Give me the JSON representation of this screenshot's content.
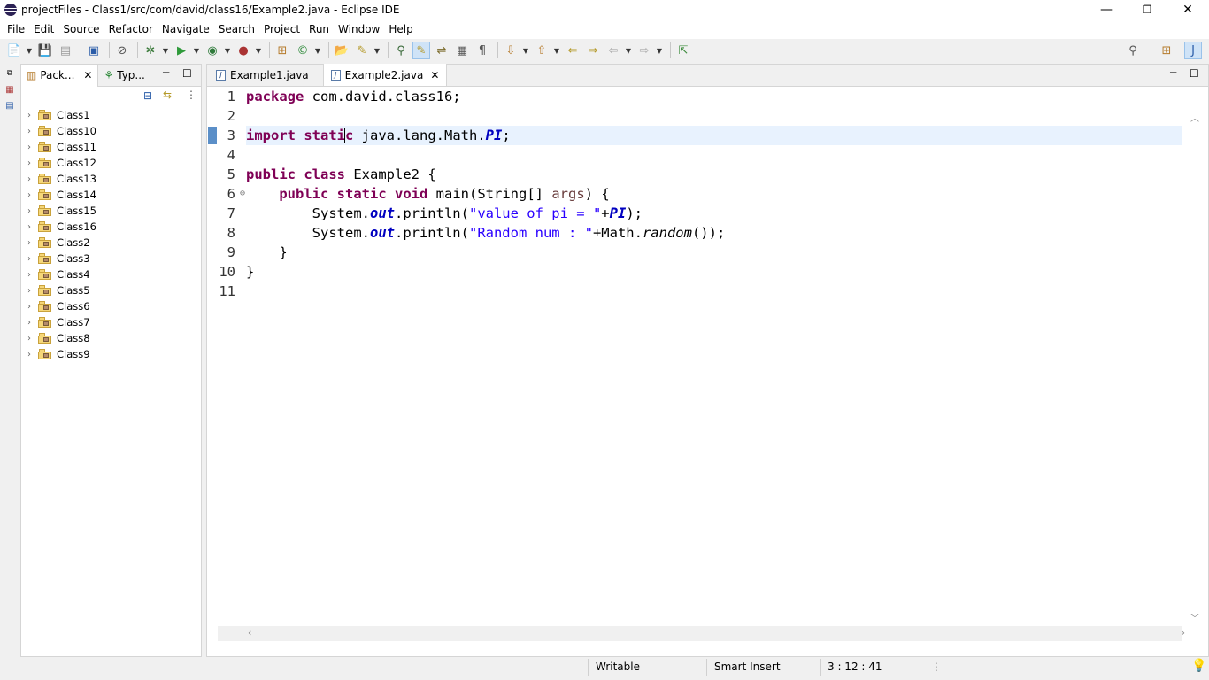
{
  "window": {
    "title": "projectFiles - Class1/src/com/david/class16/Example2.java - Eclipse IDE",
    "minimize": "—",
    "restore": "❐",
    "close": "✕"
  },
  "menu": [
    {
      "label": "File"
    },
    {
      "label": "Edit"
    },
    {
      "label": "Source"
    },
    {
      "label": "Refactor"
    },
    {
      "label": "Navigate"
    },
    {
      "label": "Search"
    },
    {
      "label": "Project"
    },
    {
      "label": "Run"
    },
    {
      "label": "Window"
    },
    {
      "label": "Help"
    }
  ],
  "package_explorer": {
    "tabs": [
      {
        "label": "Pack...",
        "icon": "package-explorer-icon"
      },
      {
        "label": "Typ...",
        "icon": "type-hierarchy-icon"
      }
    ],
    "projects": [
      "Class1",
      "Class10",
      "Class11",
      "Class12",
      "Class13",
      "Class14",
      "Class15",
      "Class16",
      "Class2",
      "Class3",
      "Class4",
      "Class5",
      "Class6",
      "Class7",
      "Class8",
      "Class9"
    ]
  },
  "editor": {
    "tabs": [
      {
        "label": "Example1.java",
        "selected": false
      },
      {
        "label": "Example2.java",
        "selected": true
      }
    ],
    "line_numbers": [
      "1",
      "2",
      "3",
      "4",
      "5",
      "6",
      "7",
      "8",
      "9",
      "10",
      "11"
    ],
    "fold_marker": "⊖",
    "code": {
      "l1_kw": "package",
      "l1_rest": " com.david.class16;",
      "l3_kw1": "import",
      "l3_kw2": "static",
      "l3_rest": " java.lang.Math.",
      "l3_field": "PI",
      "l3_end": ";",
      "l5_kw1": "public",
      "l5_kw2": "class",
      "l5_rest": " Example2 {",
      "l6_kw1": "public",
      "l6_kw2": "static",
      "l6_kw3": "void",
      "l6_rest1": " main(String[] ",
      "l6_arg": "args",
      "l6_rest2": ") {",
      "l7_a": "System.",
      "l7_field": "out",
      "l7_b": ".println(",
      "l7_str": "\"value of pi = \"",
      "l7_c": "+",
      "l7_field2": "PI",
      "l7_d": ");",
      "l8_a": "System.",
      "l8_field": "out",
      "l8_b": ".println(",
      "l8_str": "\"Random num : \"",
      "l8_c": "+Math.",
      "l8_it": "random",
      "l8_d": "());",
      "l9": "}",
      "l10": "}"
    }
  },
  "status": {
    "writable": "Writable",
    "insert_mode": "Smart Insert",
    "position": "3 : 12 : 41"
  },
  "colors": {
    "keyword": "#7f0055",
    "field": "#0000c0",
    "string": "#2a00ff",
    "current_line": "#e8f2fe"
  }
}
